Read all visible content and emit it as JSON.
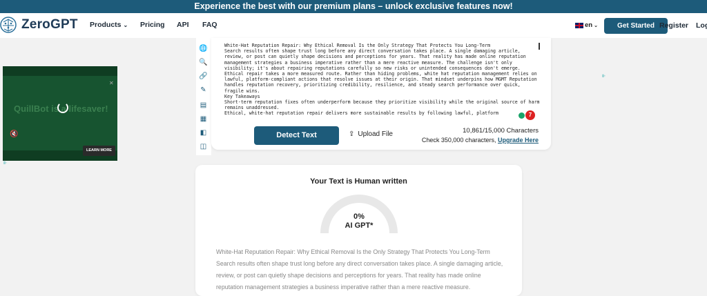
{
  "banner": {
    "text": "Experience the best with our premium plans – unlock exclusive features now!"
  },
  "nav": {
    "logo": "ZeroGPT",
    "products": "Products",
    "pricing": "Pricing",
    "api": "API",
    "faq": "FAQ",
    "lang": "en",
    "get_started": "Get Started",
    "register": "Register",
    "login": "Log"
  },
  "ad": {
    "text": "QuillBot is a lifesaver!",
    "learn_more": "LEARN MORE"
  },
  "editor": {
    "text": "White-Hat Reputation Repair: Why Ethical Removal Is the Only Strategy That Protects You Long-Term\nSearch results often shape trust long before any direct conversation takes place. A single damaging article, review, or post can quietly shape decisions and perceptions for years. That reality has made online reputation management strategies a business imperative rather than a mere reactive measure. The challenge isn't only visibility; it's about repairing reputations carefully so new risks or unintended consequences don't emerge.\nEthical repair takes a more measured route. Rather than hiding problems, white hat reputation management relies on lawful, platform-compliant actions that resolve issues at their origin. That mindset underpins how MGMT Reputation handles reputation recovery, prioritizing credibility, resilience, and steady search performance over quick, fragile wins.\nKey Takeaways\nShort-term reputation fixes often underperform because they prioritize visibility while the original source of harm remains unaddressed.\nEthical, white-hat reputation repair delivers more sustainable results by following lawful, platform",
    "badge_count": "7"
  },
  "actions": {
    "detect": "Detect Text",
    "upload": "Upload File",
    "chars": "10,861/15,000 Characters",
    "check_prefix": "Check 350,000 characters,",
    "upgrade": "Upgrade Here"
  },
  "result": {
    "title": "Your Text is Human written",
    "pct": "0%",
    "label": "AI GPT*",
    "text": "White-Hat Reputation Repair: Why Ethical Removal Is the Only Strategy That Protects You Long-Term Search results often shape trust long before any direct conversation takes place. A single damaging article, review, or post can quietly shape decisions and perceptions for years. That reality has made online reputation management strategies a business imperative rather than a mere reactive measure."
  }
}
